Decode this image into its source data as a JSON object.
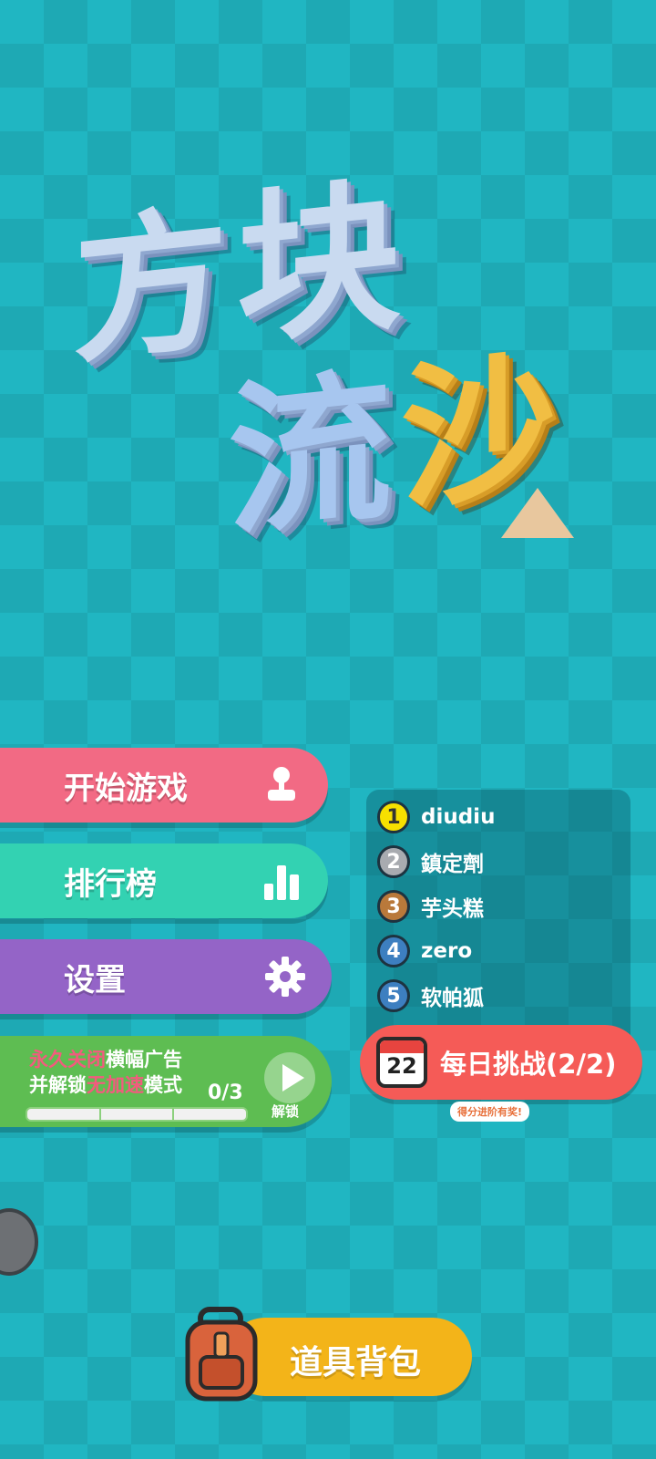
{
  "logo": {
    "chars": [
      "方",
      "块",
      "流",
      "沙"
    ]
  },
  "menu": {
    "start_label": "开始游戏",
    "rank_label": "排行榜",
    "settings_label": "设置"
  },
  "ad_card": {
    "line1_a": "永久关闭",
    "line1_b": "横幅广告",
    "line2_a": "并解锁",
    "line2_b": "无加速",
    "line2_c": "模式",
    "progress_text": "0/3",
    "progress_value": 0,
    "progress_max": 3,
    "unlock_label": "解锁"
  },
  "leaderboard": {
    "entries": [
      {
        "rank": "1",
        "name": "diudiu",
        "color": "#f7e000"
      },
      {
        "rank": "2",
        "name": "鎮定劑",
        "color": "#a8abb0"
      },
      {
        "rank": "3",
        "name": "芋头糕",
        "color": "#b9793b"
      },
      {
        "rank": "4",
        "name": "zero",
        "color": "#3d7fc0"
      },
      {
        "rank": "5",
        "name": "软帕狐",
        "color": "#3d7fc0"
      }
    ]
  },
  "daily": {
    "calendar_day": "22",
    "label": "每日挑战(2/2)",
    "tip": "得分进阶有奖!"
  },
  "bag": {
    "label": "道具背包"
  },
  "colors": {
    "background": "#20b6c2",
    "start": "#f26a84",
    "rank": "#33d2b2",
    "settings": "#9464c7",
    "ad": "#5ebd52",
    "daily": "#f55b57",
    "bag": "#f3b419"
  }
}
